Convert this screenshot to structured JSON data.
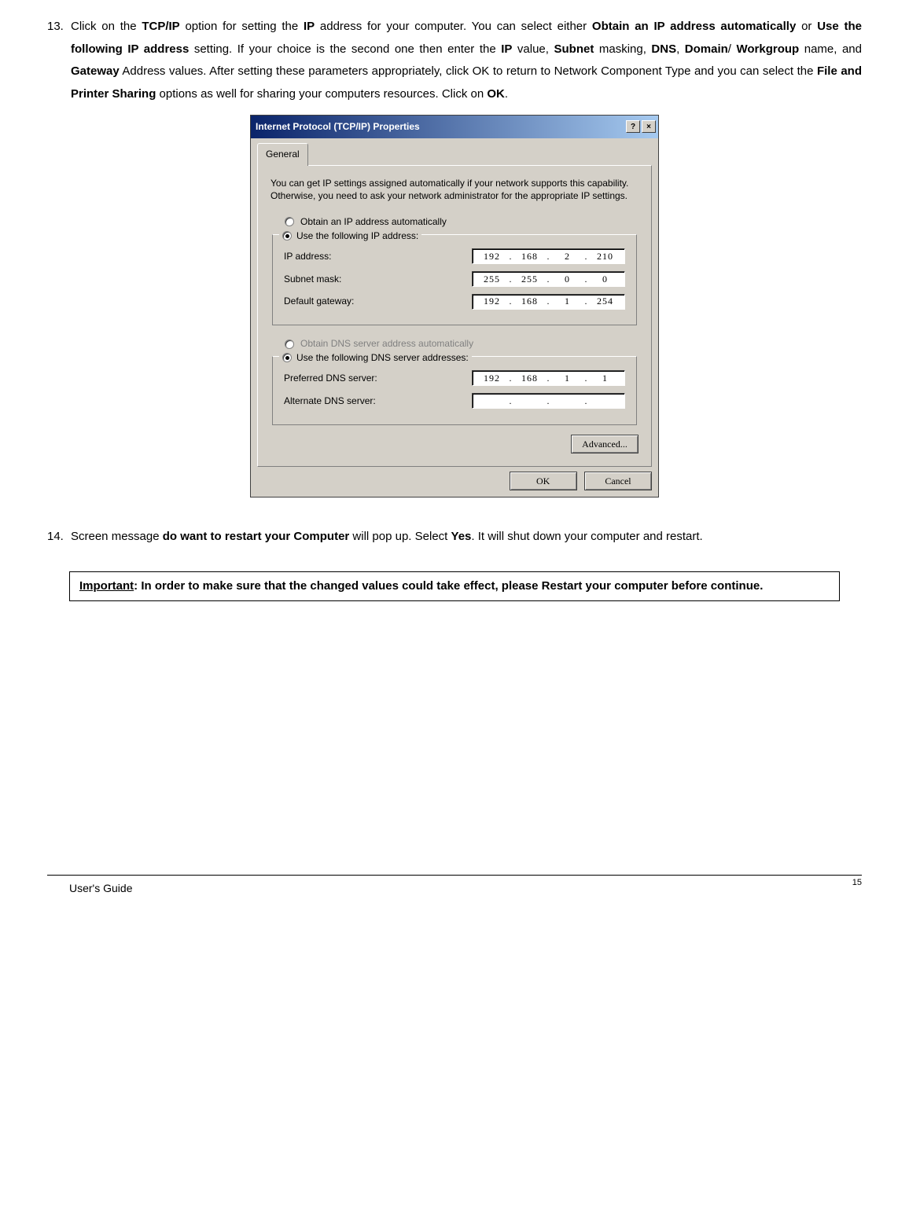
{
  "para13": {
    "number": "13.",
    "segments": [
      "Click on the ",
      "TCP/IP",
      " option for setting the ",
      "IP",
      " address for your computer. You can select either ",
      "Obtain an IP address automatically",
      " or ",
      "Use the following IP address",
      " setting. If your choice is the second one then enter the ",
      "IP",
      " value, ",
      "Subnet",
      " masking, ",
      "DNS",
      ", ",
      "Domain",
      "/",
      " Workgroup",
      " name, and ",
      "Gateway",
      " Address values. After setting these parameters appropriately, click OK to return to Network Component Type and you can select the ",
      "File and Printer Sharing",
      " options as well for sharing your computers resources. Click on ",
      "OK",
      "."
    ]
  },
  "dialog": {
    "title": "Internet Protocol (TCP/IP) Properties",
    "help_btn": "?",
    "close_btn": "×",
    "tab": "General",
    "intro": "You can get IP settings assigned automatically if your network supports this capability. Otherwise, you need to ask your network administrator for the appropriate IP settings.",
    "radio_obtain_ip": "Obtain an IP address automatically",
    "radio_use_ip": "Use the following IP address:",
    "ip_label": "IP address:",
    "ip_value": [
      "192",
      "168",
      "2",
      "210"
    ],
    "subnet_label": "Subnet mask:",
    "subnet_value": [
      "255",
      "255",
      "0",
      "0"
    ],
    "gateway_label": "Default gateway:",
    "gateway_value": [
      "192",
      "168",
      "1",
      "254"
    ],
    "radio_obtain_dns": "Obtain DNS server address automatically",
    "radio_use_dns": "Use the following DNS server addresses:",
    "pref_dns_label": "Preferred DNS server:",
    "pref_dns_value": [
      "192",
      "168",
      "1",
      "1"
    ],
    "alt_dns_label": "Alternate DNS server:",
    "alt_dns_value": [
      "",
      "",
      "",
      ""
    ],
    "advanced_btn": "Advanced...",
    "ok_btn": "OK",
    "cancel_btn": "Cancel"
  },
  "para14": {
    "number": "14.",
    "segments": [
      "Screen message ",
      "do want to restart your Computer",
      " will pop up. Select ",
      "Yes",
      ". It will shut down your computer and restart."
    ]
  },
  "note": {
    "important_label": "Important",
    "text": ": In order to make sure that the changed values could take effect, please Restart your computer before continue."
  },
  "footer": {
    "guide": "User's Guide",
    "page": "15"
  }
}
